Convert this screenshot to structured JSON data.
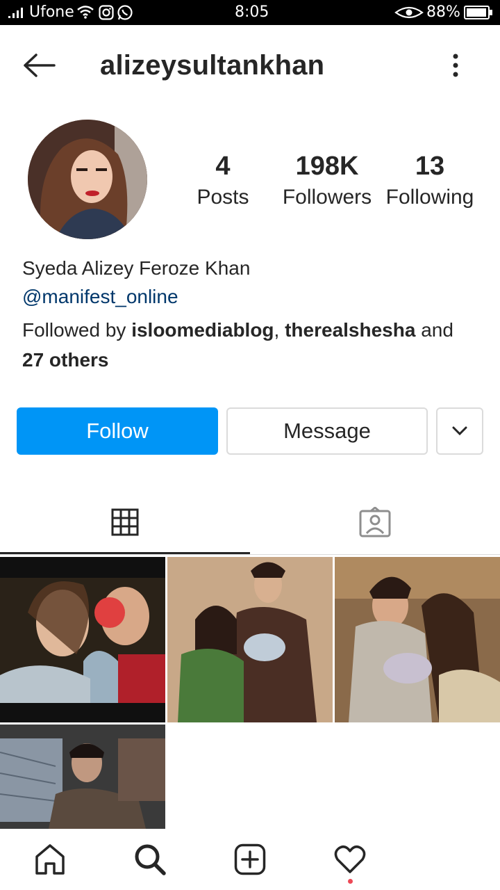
{
  "status_bar": {
    "carrier": "Ufone",
    "time": "8:05",
    "battery": "88%",
    "icons": [
      "signal-icon",
      "wifi-icon",
      "instagram-icon",
      "whatsapp-icon",
      "eye-icon",
      "battery-icon"
    ]
  },
  "header": {
    "username": "alizeysultankhan",
    "icons": [
      "back-arrow-icon",
      "more-options-icon"
    ]
  },
  "stats": {
    "posts_count": "4",
    "posts_label": "Posts",
    "followers_count": "198K",
    "followers_label": "Followers",
    "following_count": "13",
    "following_label": "Following"
  },
  "bio": {
    "full_name": "Syeda Alizey Feroze Khan",
    "link": "@manifest_online",
    "followed_prefix": "Followed by ",
    "follower_1": "isloomediablog",
    "separator": ", ",
    "follower_2": "therealshesha",
    "and_text": " and",
    "others": "27 others"
  },
  "actions": {
    "follow_label": "Follow",
    "message_label": "Message"
  },
  "tabs": [
    "grid-icon",
    "tagged-icon"
  ],
  "bottom_nav": [
    "home-icon",
    "search-icon",
    "new-post-icon",
    "activity-heart-icon"
  ],
  "colors": {
    "accent": "#0095f6",
    "link": "#00376b",
    "notification_dot": "#ed4956"
  }
}
